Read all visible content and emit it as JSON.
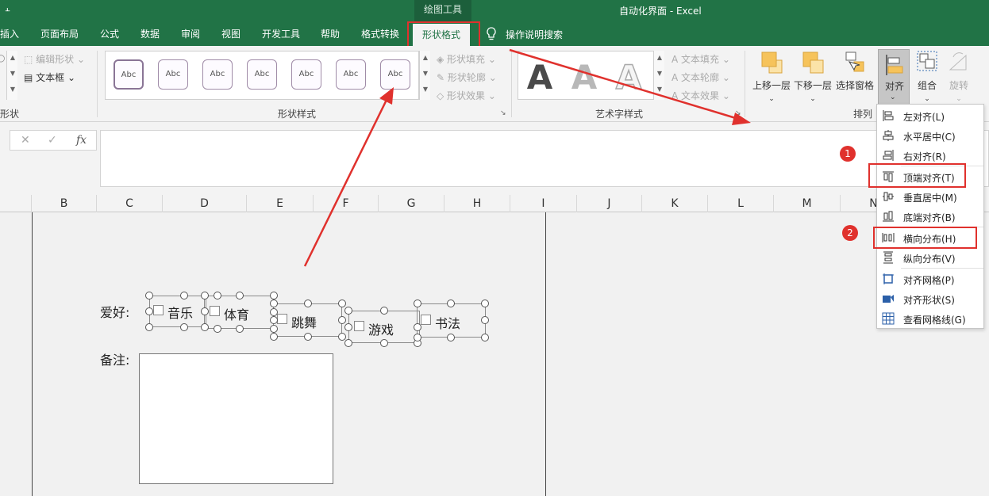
{
  "window": {
    "context_tab_group": "绘图工具",
    "title": "自动化界面  -  Excel",
    "quick_access_icon": "dropdown-arrow-icon"
  },
  "tabs": [
    {
      "label": "插入"
    },
    {
      "label": "页面布局"
    },
    {
      "label": "公式"
    },
    {
      "label": "数据"
    },
    {
      "label": "审阅"
    },
    {
      "label": "视图"
    },
    {
      "label": "开发工具"
    },
    {
      "label": "帮助"
    },
    {
      "label": "格式转换"
    },
    {
      "label": "形状格式",
      "active": true
    }
  ],
  "tell_me": {
    "label": "操作说明搜索",
    "icon": "lightbulb-icon"
  },
  "ribbon": {
    "insert_shapes": {
      "edit_shape": "编辑形状",
      "text_box": "文本框",
      "group_label": "形状"
    },
    "shape_styles": {
      "thumbnails": [
        "Abc",
        "Abc",
        "Abc",
        "Abc",
        "Abc",
        "Abc",
        "Abc"
      ],
      "fill": "形状填充",
      "outline": "形状轮廓",
      "effects": "形状效果",
      "group_label": "形状样式"
    },
    "wordart": {
      "letters": [
        "A",
        "A",
        "A"
      ],
      "fill": "文本填充",
      "outline": "文本轮廓",
      "effects": "文本效果",
      "group_label": "艺术字样式"
    },
    "arrange": {
      "bring_forward": "上移一层",
      "send_backward": "下移一层",
      "selection_pane": "选择窗格",
      "align": "对齐",
      "group": "组合",
      "rotate": "旋转",
      "group_label": "排列"
    }
  },
  "formula_bar": {
    "cancel": "✕",
    "confirm": "✓",
    "fx": "fx",
    "value": ""
  },
  "columns": [
    "B",
    "C",
    "D",
    "E",
    "F",
    "G",
    "H",
    "I",
    "J",
    "K",
    "L",
    "M",
    "N"
  ],
  "sheet": {
    "hobby_label": "爱好:",
    "notes_label": "备注:",
    "checkboxes": [
      "音乐",
      "体育",
      "跳舞",
      "游戏",
      "书法"
    ]
  },
  "align_menu": {
    "items": [
      {
        "label": "左对齐(L)",
        "icon": "align-left-icon"
      },
      {
        "label": "水平居中(C)",
        "icon": "align-center-icon"
      },
      {
        "label": "右对齐(R)",
        "icon": "align-right-icon"
      },
      {
        "label": "顶端对齐(T)",
        "icon": "align-top-icon"
      },
      {
        "label": "垂直居中(M)",
        "icon": "align-middle-icon"
      },
      {
        "label": "底端对齐(B)",
        "icon": "align-bottom-icon"
      },
      {
        "label": "横向分布(H)",
        "icon": "distribute-horizontal-icon"
      },
      {
        "label": "纵向分布(V)",
        "icon": "distribute-vertical-icon"
      },
      {
        "label": "对齐网格(P)",
        "icon": "snap-grid-icon"
      },
      {
        "label": "对齐形状(S)",
        "icon": "snap-shape-icon"
      },
      {
        "label": "查看网格线(G)",
        "icon": "view-gridlines-icon"
      }
    ]
  },
  "annotations": {
    "step1": "1",
    "step2": "2"
  },
  "colors": {
    "excel_green": "#217346",
    "highlight_red": "#e0312d"
  }
}
